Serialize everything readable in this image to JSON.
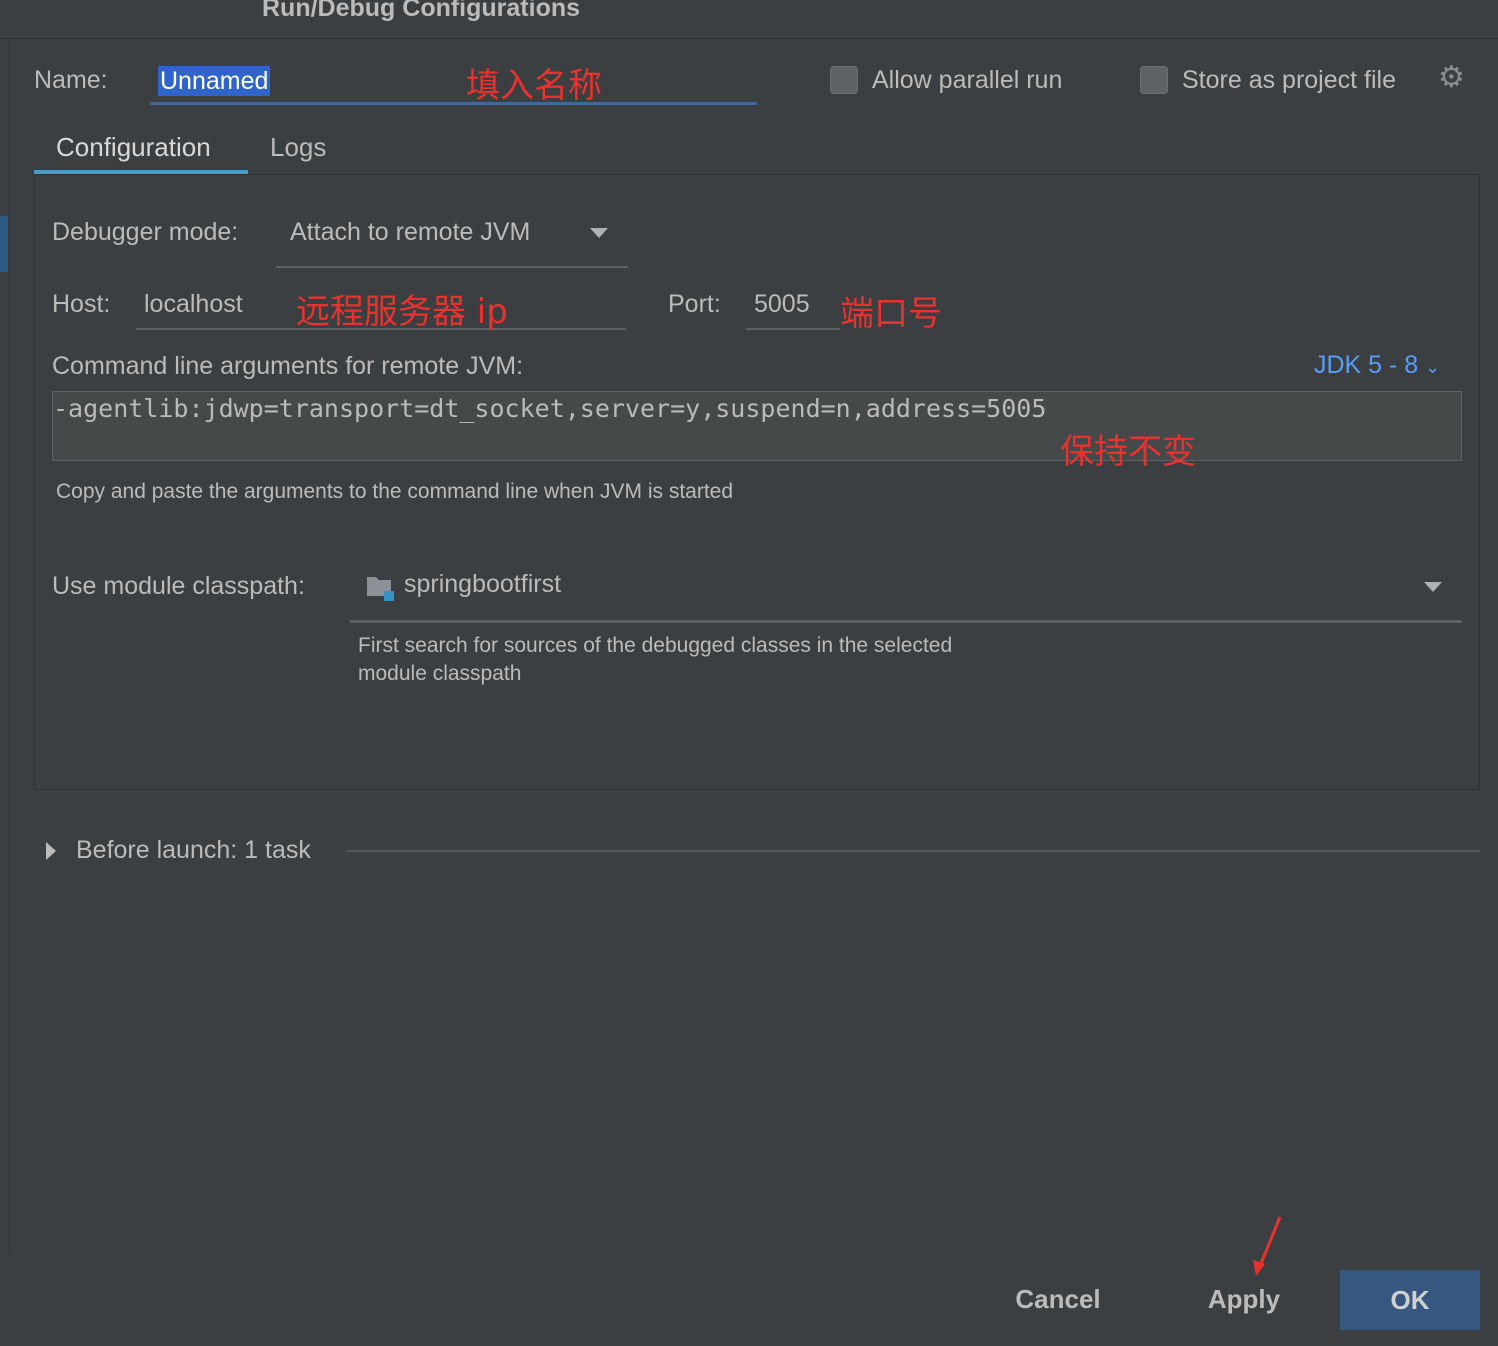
{
  "window": {
    "title": "Run/Debug Configurations"
  },
  "name_row": {
    "label": "Name:",
    "value": "Unnamed",
    "annotation": "填入名称",
    "allow_parallel_run": {
      "label": "Allow parallel run",
      "checked": false
    },
    "store_as_project_file": {
      "label": "Store as project file",
      "checked": false
    },
    "icon": "gear-icon"
  },
  "tabs": [
    {
      "label": "Configuration",
      "active": true
    },
    {
      "label": "Logs",
      "active": false
    }
  ],
  "debugger": {
    "label": "Debugger mode:",
    "value": "Attach to remote JVM"
  },
  "host": {
    "label": "Host:",
    "value": "localhost",
    "annotation": "远程服务器 ip"
  },
  "port": {
    "label": "Port:",
    "value": "5005",
    "annotation": "端口号"
  },
  "command_line": {
    "label": "Command line arguments for remote JVM:",
    "jdk_link": "JDK 5 - 8",
    "value": "-agentlib:jdwp=transport=dt_socket,server=y,suspend=n,address=5005",
    "annotation": "保持不变",
    "hint": "Copy and paste the arguments to the command line when JVM is started"
  },
  "module_classpath": {
    "label": "Use module classpath:",
    "value": "springbootfirst",
    "hint_line1": "First search for sources of the debugged classes in the selected",
    "hint_line2": "module classpath"
  },
  "before_launch": {
    "label": "Before launch: 1 task"
  },
  "buttons": {
    "cancel": "Cancel",
    "apply": "Apply",
    "ok": "OK"
  },
  "colors": {
    "background": "#3c3f41",
    "accent_tab": "#4a9cc8",
    "selection": "#2f65ca",
    "link": "#589df6",
    "annotation": "#e8322f",
    "ok_button": "#365880"
  }
}
